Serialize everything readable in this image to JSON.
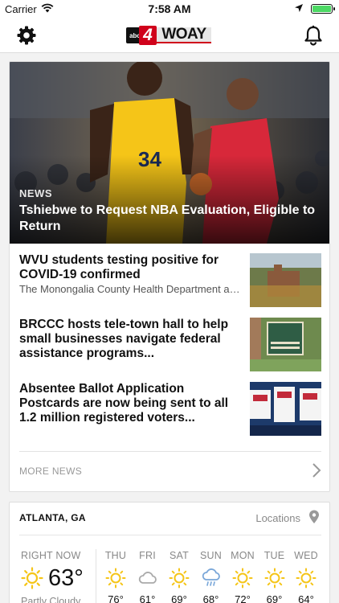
{
  "status_bar": {
    "carrier": "Carrier",
    "time": "7:58 AM",
    "battery_level": 1.0
  },
  "header": {
    "logo_abc": "abc",
    "logo_number": "4",
    "logo_callsign": "WOAY"
  },
  "featured": {
    "category": "NEWS",
    "headline": "Tshiebwe to Request NBA Evaluation, Eligible to Return",
    "jersey_number": "34"
  },
  "stories": [
    {
      "title": "WVU students testing positive for COVID-19 confirmed",
      "summary": "The Monongalia County Health Department and West Virginia University were notified t..."
    },
    {
      "title": "BRCCC hosts tele-town hall to help small businesses navigate federal assistance programs..."
    },
    {
      "title": "Absentee Ballot Application Postcards are now being sent to all 1.2 million registered voters..."
    }
  ],
  "more_news_label": "MORE NEWS",
  "weather": {
    "city": "ATLANTA, GA",
    "locations_label": "Locations",
    "now": {
      "label": "RIGHT NOW",
      "temp": "63°",
      "condition": "Partly Cloudy",
      "icon": "sun-icon"
    },
    "forecast": [
      {
        "day": "THU",
        "temp": "76°",
        "icon": "sun-icon"
      },
      {
        "day": "FRI",
        "temp": "61°",
        "icon": "cloud-icon"
      },
      {
        "day": "SAT",
        "temp": "69°",
        "icon": "sun-icon"
      },
      {
        "day": "SUN",
        "temp": "68°",
        "icon": "rain-icon"
      },
      {
        "day": "MON",
        "temp": "72°",
        "icon": "sun-icon"
      },
      {
        "day": "TUE",
        "temp": "69°",
        "icon": "sun-icon"
      },
      {
        "day": "WED",
        "temp": "64°",
        "icon": "sun-icon"
      }
    ]
  },
  "colors": {
    "accent_red": "#d0021b",
    "sun_yellow": "#f5c518",
    "battery_green": "#4cd964"
  }
}
